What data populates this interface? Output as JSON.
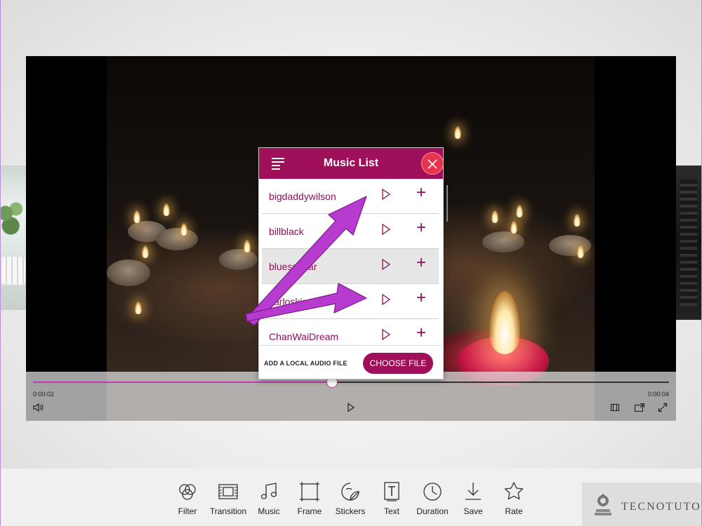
{
  "dialog": {
    "title": "Music List",
    "items": [
      {
        "name": "bigdaddywilson"
      },
      {
        "name": "billblack"
      },
      {
        "name": "bluesguitar"
      },
      {
        "name": "carloskiss"
      },
      {
        "name": "ChanWaiDream"
      }
    ],
    "footer_label": "ADD A LOCAL AUDIO FILE",
    "choose_button": "CHOOSE FILE"
  },
  "player": {
    "current_time": "0:00:02",
    "total_time": "0:00:04",
    "progress": 0.47
  },
  "toolbar": {
    "items": [
      {
        "label": "Filter",
        "icon": "filter-icon"
      },
      {
        "label": "Transition",
        "icon": "transition-icon"
      },
      {
        "label": "Music",
        "icon": "music-icon"
      },
      {
        "label": "Frame",
        "icon": "frame-icon"
      },
      {
        "label": "Stickers",
        "icon": "stickers-icon"
      },
      {
        "label": "Text",
        "icon": "text-icon"
      },
      {
        "label": "Duration",
        "icon": "duration-icon"
      },
      {
        "label": "Save",
        "icon": "save-icon"
      },
      {
        "label": "Rate",
        "icon": "rate-icon"
      }
    ]
  },
  "watermark": {
    "text": "TECNOTUTO"
  },
  "colors": {
    "accent": "#a0105a",
    "close": "#e8334f",
    "annotation_arrow": "#b83bd0",
    "seek": "#c23db5"
  }
}
